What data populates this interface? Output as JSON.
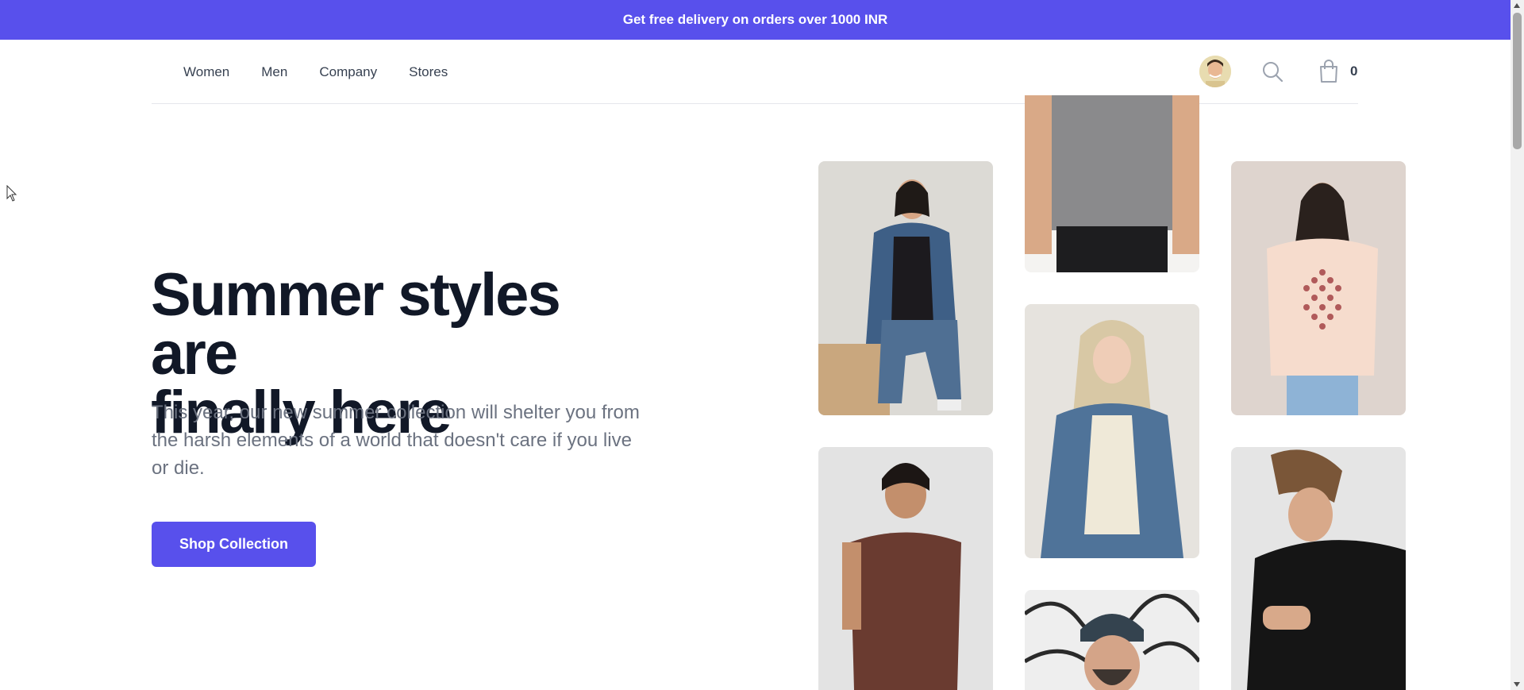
{
  "promo": {
    "text": "Get free delivery on orders over 1000 INR"
  },
  "nav": {
    "links": [
      "Women",
      "Men",
      "Company",
      "Stores"
    ],
    "cart_count": "0"
  },
  "hero": {
    "title_line1": "Summer styles are",
    "title_line2": "finally here",
    "description": "This year, our new summer collection will shelter you from the harsh elements of a world that doesn't care if you live or die.",
    "cta_label": "Shop Collection"
  },
  "colors": {
    "accent": "#5850ec",
    "heading": "#111827",
    "body_text": "#6b7280"
  },
  "icons": [
    "user-avatar",
    "search-icon",
    "shopping-bag-icon"
  ]
}
